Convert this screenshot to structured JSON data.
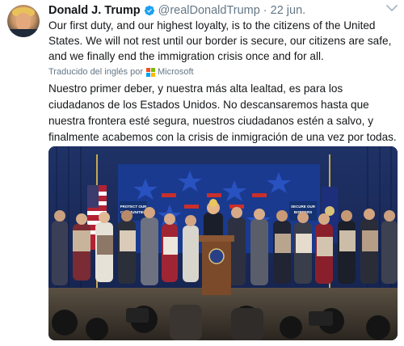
{
  "tweet": {
    "author_name": "Donald J. Trump",
    "author_handle": "@realDonaldTrump",
    "separator": "·",
    "timestamp": "22 jun.",
    "text": "Our first duty, and our highest loyalty, is to the citizens of the United States. We will not rest until our border is secure, our citizens are safe, and we finally end the immigration crisis once and for all.",
    "translated_label": "Traducido del inglés por",
    "translator": "Microsoft",
    "translation": "Nuestro primer deber, y nuestra más alta lealtad, es para los ciudadanos de los Estados Unidos. No descansaremos hasta que nuestra frontera esté segura, nuestros ciudadanos estén a salvo, y finalmente acabemos con la crisis de inmigración de una vez por todas."
  },
  "photo": {
    "banner_left": "PROTECT OUR COMMUNITIES",
    "banner_right": "SECURE OUR BORDERS"
  },
  "colors": {
    "verified": "#1da1f2",
    "secondary_text": "#657786",
    "ms_red": "#f25022",
    "ms_green": "#7fba00",
    "ms_blue": "#00a4ef",
    "ms_yellow": "#ffb900"
  },
  "icons": {
    "verified": "verified-badge-icon",
    "more": "chevron-down-icon",
    "translator_logo": "microsoft-logo-icon"
  }
}
